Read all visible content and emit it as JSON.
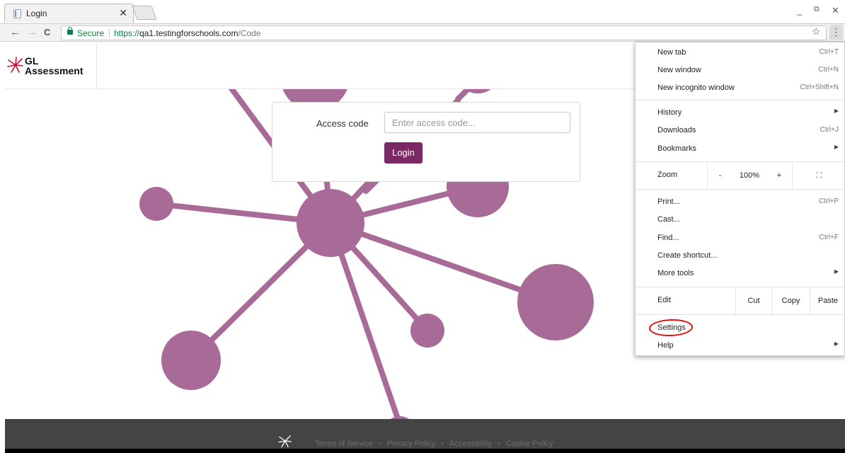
{
  "browser": {
    "tab_title": "Login",
    "tab_close": "✕",
    "url_secure_label": "Secure",
    "url_scheme": "https://",
    "url_host": "qa1.testingforschools.com",
    "url_path": "/Code",
    "window_minimize": "_",
    "window_restore": "⧉",
    "window_close": "✕",
    "back": "←",
    "forward": "→",
    "reload": "C",
    "star": "☆",
    "menu_icon": "⋮"
  },
  "site": {
    "logo_line1": "GL",
    "logo_line2": "Assessment",
    "brand_color": "#7b2a66",
    "network_color": "#a86a96"
  },
  "login": {
    "label": "Access code",
    "placeholder": "Enter access code...",
    "button": "Login"
  },
  "footer": {
    "links": [
      "Terms of Service",
      "Privacy Policy",
      "Accessibility",
      "Cookie Policy"
    ],
    "bullet": "•"
  },
  "menu": {
    "new_tab": {
      "label": "New tab",
      "shortcut": "Ctrl+T"
    },
    "new_window": {
      "label": "New window",
      "shortcut": "Ctrl+N"
    },
    "new_incognito": {
      "label": "New incognito window",
      "shortcut": "Ctrl+Shift+N"
    },
    "history": {
      "label": "History",
      "arrow": "▶"
    },
    "downloads": {
      "label": "Downloads",
      "shortcut": "Ctrl+J"
    },
    "bookmarks": {
      "label": "Bookmarks",
      "arrow": "▶"
    },
    "zoom": {
      "label": "Zoom",
      "minus": "-",
      "value": "100%",
      "plus": "+",
      "fullscreen": "⛶"
    },
    "print": {
      "label": "Print...",
      "shortcut": "Ctrl+P"
    },
    "cast": {
      "label": "Cast..."
    },
    "find": {
      "label": "Find...",
      "shortcut": "Ctrl+F"
    },
    "create_shortcut": {
      "label": "Create shortcut..."
    },
    "more_tools": {
      "label": "More tools",
      "arrow": "▶"
    },
    "edit": {
      "label": "Edit",
      "cut": "Cut",
      "copy": "Copy",
      "paste": "Paste"
    },
    "settings": {
      "label": "Settings"
    },
    "help": {
      "label": "Help",
      "arrow": "▶"
    },
    "annotation_color": "#e0100c"
  }
}
